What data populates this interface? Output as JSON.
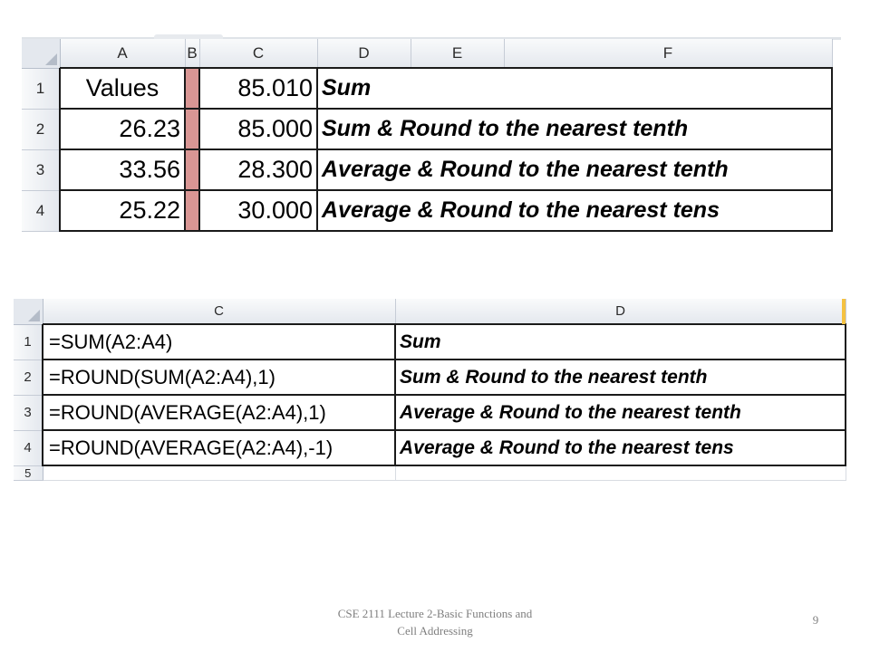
{
  "top_sheet": {
    "columns": [
      "A",
      "B",
      "C",
      "D",
      "E",
      "F"
    ],
    "rows": [
      {
        "row": "1",
        "a": "Values",
        "c": "85.010",
        "d": "Sum"
      },
      {
        "row": "2",
        "a": "26.23",
        "c": "85.000",
        "d": "Sum & Round to the nearest tenth"
      },
      {
        "row": "3",
        "a": "33.56",
        "c": "28.300",
        "d": "Average & Round to the nearest tenth"
      },
      {
        "row": "4",
        "a": "25.22",
        "c": "30.000",
        "d": "Average & Round to the nearest tens"
      }
    ],
    "column_b_fill": "#d99694"
  },
  "bottom_sheet": {
    "columns": [
      "C",
      "D"
    ],
    "rows": [
      {
        "row": "1",
        "c": "=SUM(A2:A4)",
        "d": "Sum"
      },
      {
        "row": "2",
        "c": "=ROUND(SUM(A2:A4),1)",
        "d": "Sum & Round to the nearest tenth"
      },
      {
        "row": "3",
        "c": "=ROUND(AVERAGE(A2:A4),1)",
        "d": "Average & Round to the nearest tenth"
      },
      {
        "row": "4",
        "c": "=ROUND(AVERAGE(A2:A4),-1)",
        "d": "Average & Round to the nearest tens"
      }
    ],
    "partial_row": "5"
  },
  "footer": {
    "line1": "CSE 2111 Lecture 2-Basic Functions and",
    "line2": "Cell Addressing",
    "page_number": "9"
  }
}
